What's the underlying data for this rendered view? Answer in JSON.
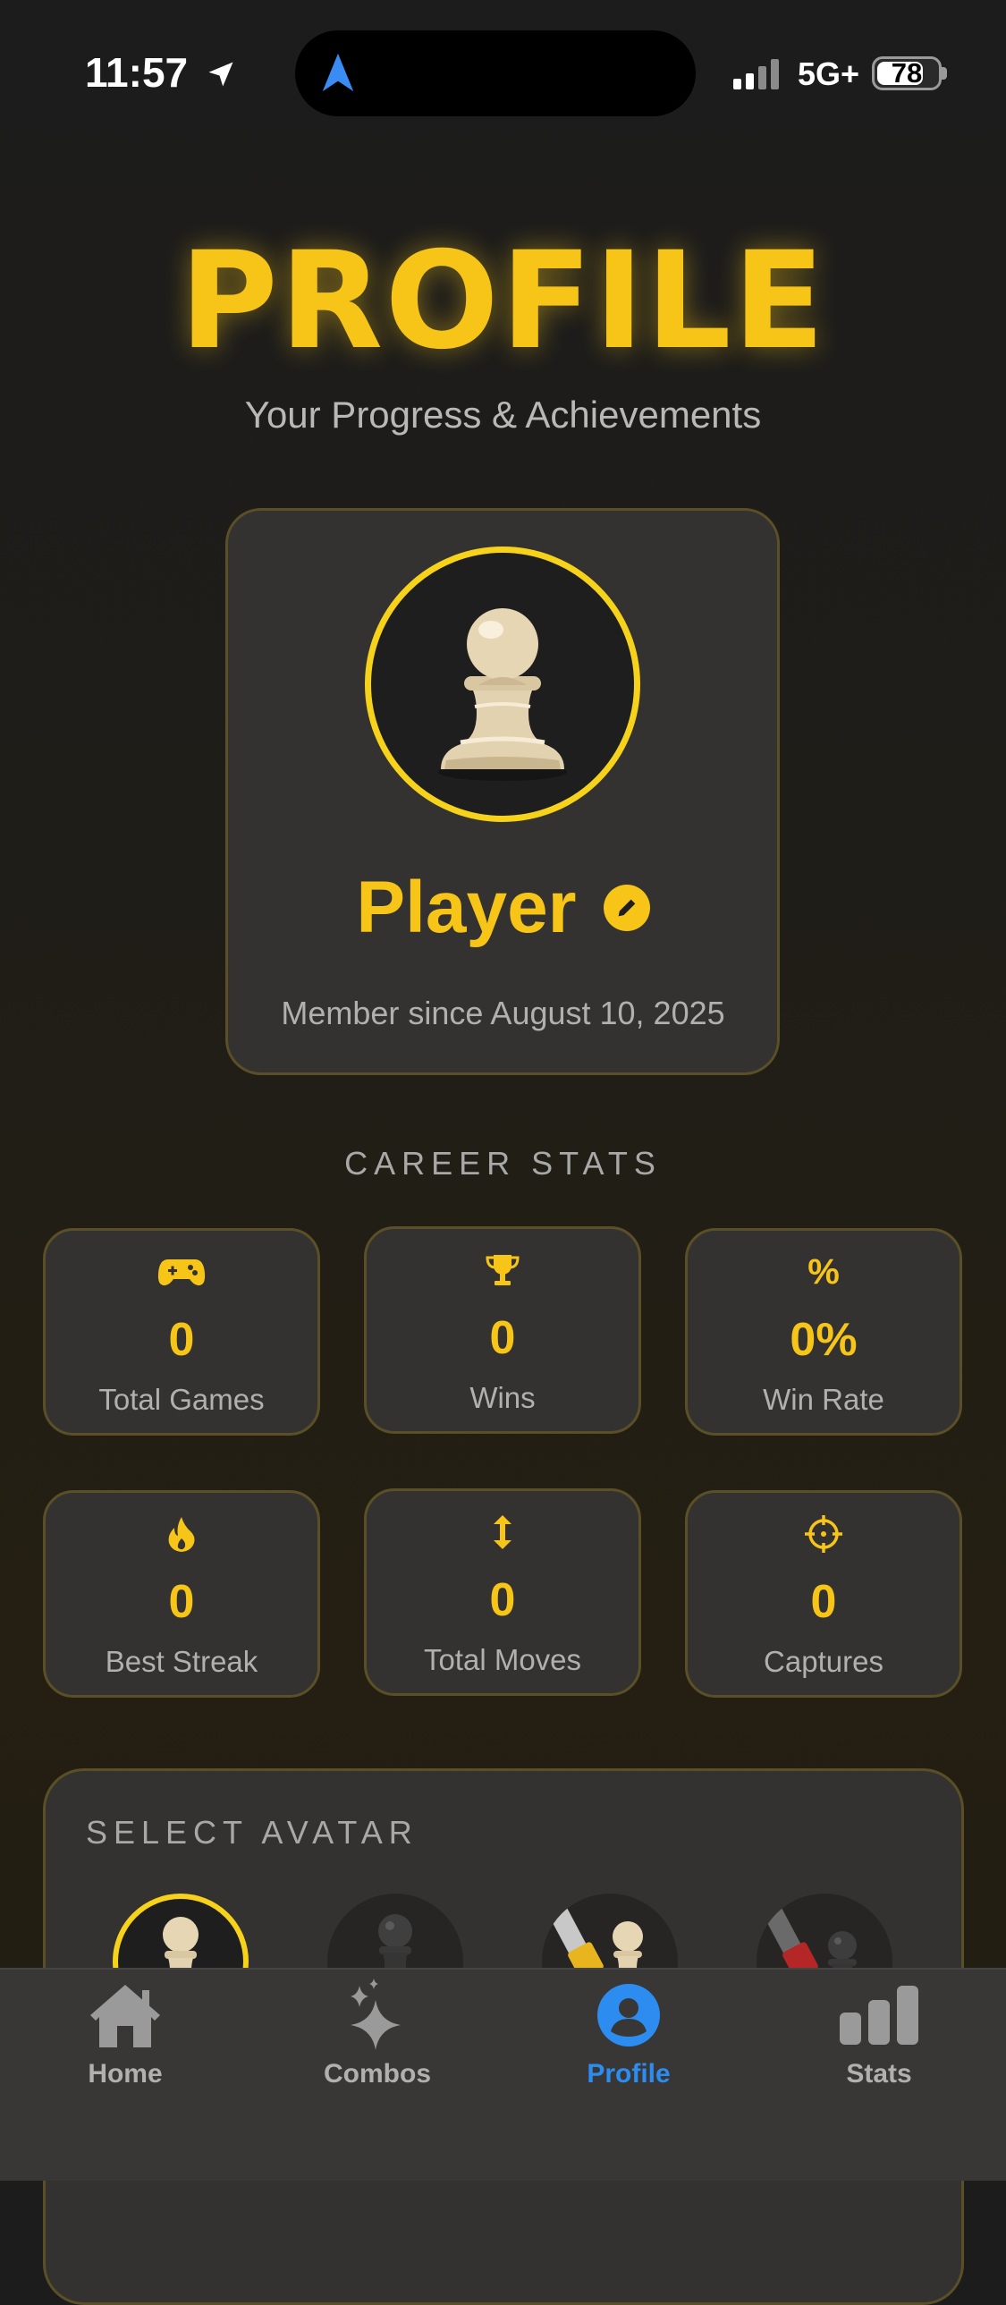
{
  "status_bar": {
    "time": "11:57",
    "network": "5G+",
    "battery": "78",
    "battery_level_percent": 78
  },
  "header": {
    "title": "PROFILE",
    "subtitle": "Your Progress & Achievements"
  },
  "profile": {
    "name": "Player",
    "member_since": "Member since August 10, 2025"
  },
  "career_stats": {
    "label": "CAREER STATS",
    "items": [
      {
        "icon": "gamepad-icon",
        "value": "0",
        "label": "Total Games"
      },
      {
        "icon": "trophy-icon",
        "value": "0",
        "label": "Wins"
      },
      {
        "icon": "percent-icon",
        "value": "0%",
        "label": "Win Rate"
      },
      {
        "icon": "flame-icon",
        "value": "0",
        "label": "Best Streak"
      },
      {
        "icon": "up-down-arrows-icon",
        "value": "0",
        "label": "Total Moves"
      },
      {
        "icon": "crosshair-icon",
        "value": "0",
        "label": "Captures"
      }
    ]
  },
  "avatar_section": {
    "label": "SELECT AVATAR"
  },
  "tabs": [
    {
      "label": "Home",
      "icon": "house-icon"
    },
    {
      "label": "Combos",
      "icon": "sparkles-icon"
    },
    {
      "label": "Profile",
      "icon": "person-circle-icon",
      "active": true
    },
    {
      "label": "Stats",
      "icon": "bar-chart-icon"
    }
  ],
  "colors": {
    "accent": "#f6c518",
    "active_tab": "#2d8cf0",
    "card_bg": "#333230",
    "card_border": "#5a4f26"
  }
}
